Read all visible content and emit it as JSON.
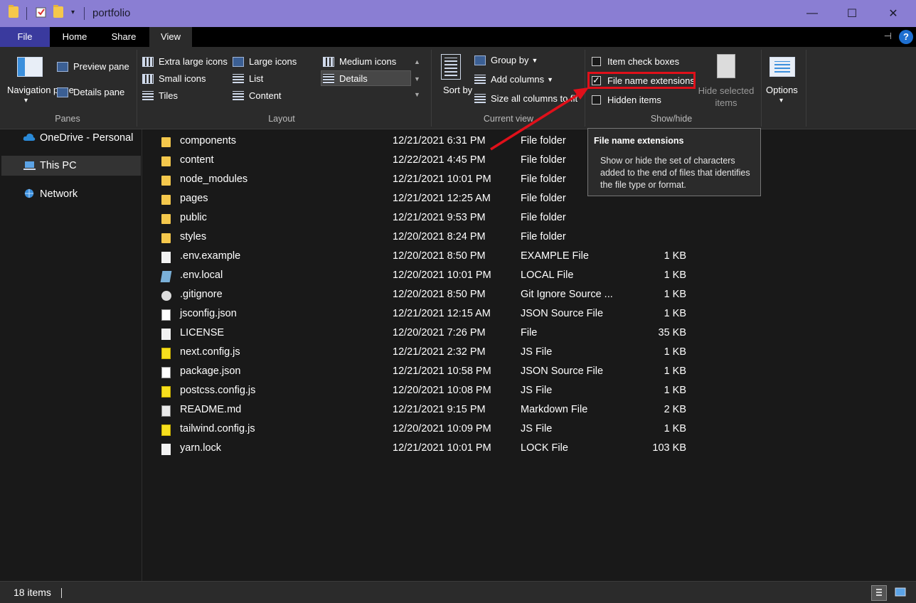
{
  "window": {
    "title": "portfolio",
    "controls": {
      "minimize": "—",
      "maximize": "☐",
      "close": "✕"
    }
  },
  "ribbon_tabs": [
    "File",
    "Home",
    "Share",
    "View"
  ],
  "ribbon": {
    "panes": {
      "navigation_pane": "Navigation pane",
      "preview_pane": "Preview pane",
      "details_pane": "Details pane",
      "group_label": "Panes"
    },
    "layout": {
      "items": [
        "Extra large icons",
        "Large icons",
        "Medium icons",
        "Small icons",
        "List",
        "Details",
        "Tiles",
        "Content"
      ],
      "selected": "Details",
      "group_label": "Layout"
    },
    "current_view": {
      "sort_by": "Sort by",
      "group_by": "Group by",
      "add_columns": "Add columns",
      "size_all_columns": "Size all columns to fit",
      "group_label": "Current view"
    },
    "show_hide": {
      "item_check_boxes": {
        "label": "Item check boxes",
        "checked": false
      },
      "file_name_extensions": {
        "label": "File name extensions",
        "checked": true
      },
      "hidden_items": {
        "label": "Hidden items",
        "checked": false
      },
      "hide_selected_items": "Hide selected items",
      "group_label": "Show/hide"
    },
    "options": "Options"
  },
  "tooltip": {
    "title": "File name extensions",
    "body": "Show or hide the set of characters added to the end of files that identifies the file type or format."
  },
  "nav": [
    {
      "label": "OneDrive - Personal",
      "icon": "cloud-icon",
      "selected": false
    },
    {
      "label": "This PC",
      "icon": "computer-icon",
      "selected": true
    },
    {
      "label": "Network",
      "icon": "network-icon",
      "selected": false
    }
  ],
  "files": [
    {
      "name": "components",
      "date": "12/21/2021 6:31 PM",
      "type": "File folder",
      "size": "",
      "icon": "folder"
    },
    {
      "name": "content",
      "date": "12/22/2021 4:45 PM",
      "type": "File folder",
      "size": "",
      "icon": "folder"
    },
    {
      "name": "node_modules",
      "date": "12/21/2021 10:01 PM",
      "type": "File folder",
      "size": "",
      "icon": "folder"
    },
    {
      "name": "pages",
      "date": "12/21/2021 12:25 AM",
      "type": "File folder",
      "size": "",
      "icon": "folder"
    },
    {
      "name": "public",
      "date": "12/21/2021 9:53 PM",
      "type": "File folder",
      "size": "",
      "icon": "folder"
    },
    {
      "name": "styles",
      "date": "12/20/2021 8:24 PM",
      "type": "File folder",
      "size": "",
      "icon": "folder"
    },
    {
      "name": ".env.example",
      "date": "12/20/2021 8:50 PM",
      "type": "EXAMPLE File",
      "size": "1 KB",
      "icon": "doc"
    },
    {
      "name": ".env.local",
      "date": "12/20/2021 10:01 PM",
      "type": "LOCAL File",
      "size": "1 KB",
      "icon": "local"
    },
    {
      "name": ".gitignore",
      "date": "12/20/2021 8:50 PM",
      "type": "Git Ignore Source ...",
      "size": "1 KB",
      "icon": "gear"
    },
    {
      "name": "jsconfig.json",
      "date": "12/21/2021 12:15 AM",
      "type": "JSON Source File",
      "size": "1 KB",
      "icon": "json"
    },
    {
      "name": "LICENSE",
      "date": "12/20/2021 7:26 PM",
      "type": "File",
      "size": "35 KB",
      "icon": "doc"
    },
    {
      "name": "next.config.js",
      "date": "12/21/2021 2:32 PM",
      "type": "JS File",
      "size": "1 KB",
      "icon": "js"
    },
    {
      "name": "package.json",
      "date": "12/21/2021 10:58 PM",
      "type": "JSON Source File",
      "size": "1 KB",
      "icon": "json"
    },
    {
      "name": "postcss.config.js",
      "date": "12/20/2021 10:08 PM",
      "type": "JS File",
      "size": "1 KB",
      "icon": "js"
    },
    {
      "name": "README.md",
      "date": "12/21/2021 9:15 PM",
      "type": "Markdown File",
      "size": "2 KB",
      "icon": "md"
    },
    {
      "name": "tailwind.config.js",
      "date": "12/20/2021 10:09 PM",
      "type": "JS File",
      "size": "1 KB",
      "icon": "js"
    },
    {
      "name": "yarn.lock",
      "date": "12/21/2021 10:01 PM",
      "type": "LOCK File",
      "size": "103 KB",
      "icon": "doc"
    }
  ],
  "status": {
    "item_count": "18 items"
  },
  "colors": {
    "titlebar": "#8a7ed3",
    "file_tab": "#3a3a9e",
    "highlight": "#e0101a",
    "folder": "#f5c84c"
  }
}
